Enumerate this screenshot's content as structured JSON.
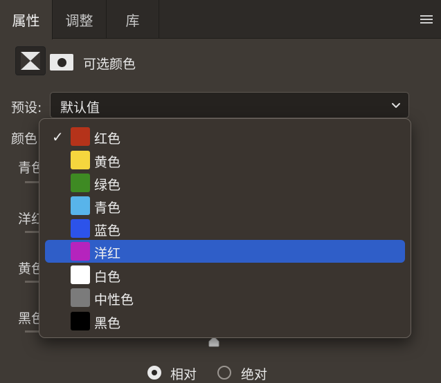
{
  "tabs": [
    {
      "label": "属性",
      "active": true
    },
    {
      "label": "调整",
      "active": false
    },
    {
      "label": "库",
      "active": false
    }
  ],
  "panel": {
    "title": "可选颜色"
  },
  "preset": {
    "label": "预设:",
    "value": "默认值"
  },
  "colors": {
    "label": "颜色"
  },
  "sliders": [
    {
      "label": "青色"
    },
    {
      "label": "洋红"
    },
    {
      "label": "黄色"
    },
    {
      "label": "黑色"
    }
  ],
  "dropdown": {
    "items": [
      {
        "label": "红色",
        "color": "#b5331a",
        "checked": true,
        "highlighted": false
      },
      {
        "label": "黄色",
        "color": "#f5d63e",
        "checked": false,
        "highlighted": false
      },
      {
        "label": "绿色",
        "color": "#3e8a23",
        "checked": false,
        "highlighted": false
      },
      {
        "label": "青色",
        "color": "#58b4ea",
        "checked": false,
        "highlighted": false
      },
      {
        "label": "蓝色",
        "color": "#2c53ea",
        "checked": false,
        "highlighted": false
      },
      {
        "label": "洋红",
        "color": "#b524bd",
        "checked": false,
        "highlighted": true
      },
      {
        "label": "白色",
        "color": "#ffffff",
        "checked": false,
        "highlighted": false
      },
      {
        "label": "中性色",
        "color": "#7b7b7b",
        "checked": false,
        "highlighted": false
      },
      {
        "label": "黑色",
        "color": "#000000",
        "checked": false,
        "highlighted": false
      }
    ]
  },
  "mode": {
    "relative_label": "相对",
    "absolute_label": "绝对",
    "selected": "relative"
  }
}
